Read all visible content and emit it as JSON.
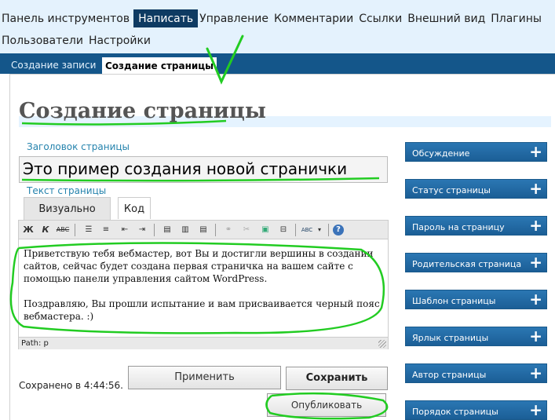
{
  "top_menu": [
    {
      "label": "Панель инструментов",
      "current": false
    },
    {
      "label": "Написать",
      "current": true
    },
    {
      "label": "Управление",
      "current": false
    },
    {
      "label": "Комментарии",
      "current": false
    },
    {
      "label": "Ссылки",
      "current": false
    },
    {
      "label": "Внешний вид",
      "current": false
    },
    {
      "label": "Плагины",
      "current": false
    }
  ],
  "top_menu_row2": [
    "Пользователи",
    "Настройки"
  ],
  "sub_menu": [
    "Создание записи",
    "Создание страницы"
  ],
  "page_title": "Создание страницы",
  "title_field": {
    "label": "Заголовок страницы",
    "value": "Это пример создания новой странички"
  },
  "text_label": "Текст страницы",
  "editor_tabs": [
    "Визуально",
    "Код"
  ],
  "toolbar": {
    "bold": "Ж",
    "italic": "К",
    "strike": "ABC",
    "spell": "ABC"
  },
  "editor_paragraphs": [
    "Приветствую тебя вебмастер, вот Вы и достигли вершины в создании сайтов, сейчас будет создана первая страничка на вашем сайте с помощью панели управления сайтом WordPress.",
    "Поздравляю, Вы прошли испытание и вам присваивается черный пояс вебмастера. :)"
  ],
  "path": "Path: p",
  "saved": "Сохранено в 4:44:56.",
  "buttons": {
    "apply": "Применить",
    "save": "Сохранить",
    "publish": "Опубликовать"
  },
  "sidebar": [
    "Обсуждение",
    "Статус страницы",
    "Пароль на страницу",
    "Родительская страница",
    "Шаблон страницы",
    "Ярлык страницы",
    "Автор страницы",
    "Порядок страницы"
  ],
  "colors": {
    "nav_bg": "#e4f2fd",
    "current_nav": "#0e3b62",
    "submenu_bg": "#14568a",
    "sidebox": "#1b5e96",
    "annotation": "#22cc22"
  }
}
